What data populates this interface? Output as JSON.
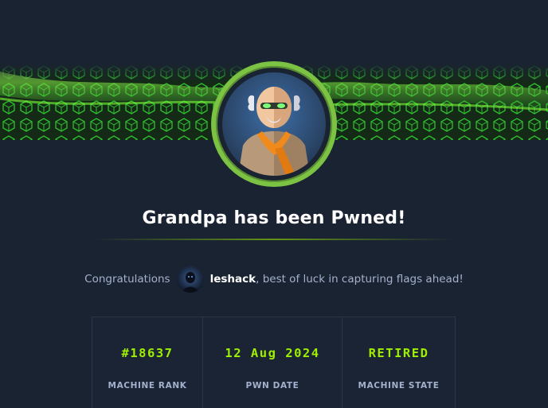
{
  "header": {
    "title": "Grandpa has been Pwned!"
  },
  "congrats": {
    "prefix": "Congratulations",
    "username": "leshack",
    "suffix": ", best of luck in capturing flags ahead!"
  },
  "stats": [
    {
      "value": "#18637",
      "label": "MACHINE RANK"
    },
    {
      "value": "12 Aug 2024",
      "label": "PWN DATE"
    },
    {
      "value": "RETIRED",
      "label": "MACHINE STATE"
    }
  ],
  "colors": {
    "background": "#1a2332",
    "accent_green": "#9fef00",
    "ring_green": "#7cc243",
    "muted_text": "#a4b1cd"
  },
  "icons": {
    "banner": "green-cube-wave-banner",
    "machine_avatar": "grandpa-machine-avatar",
    "user_avatar": "user-avatar"
  }
}
